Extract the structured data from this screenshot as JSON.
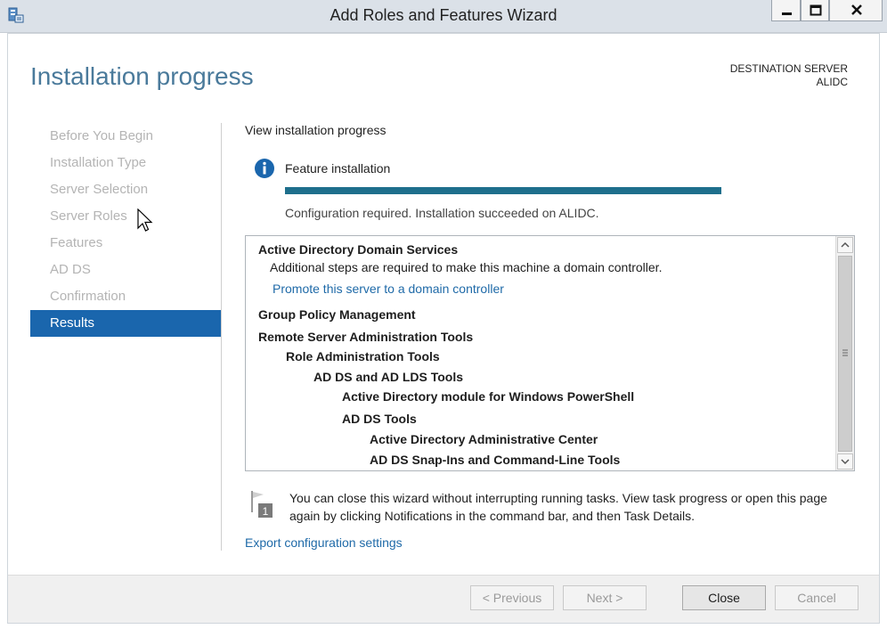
{
  "window": {
    "title": "Add Roles and Features Wizard",
    "icon": "server-manager-icon"
  },
  "header": {
    "page_title": "Installation progress",
    "destination_label": "DESTINATION SERVER",
    "destination_server": "ALIDC"
  },
  "sidebar": {
    "items": [
      {
        "label": "Before You Begin",
        "active": false
      },
      {
        "label": "Installation Type",
        "active": false
      },
      {
        "label": "Server Selection",
        "active": false
      },
      {
        "label": "Server Roles",
        "active": false
      },
      {
        "label": "Features",
        "active": false
      },
      {
        "label": "AD DS",
        "active": false
      },
      {
        "label": "Confirmation",
        "active": false
      },
      {
        "label": "Results",
        "active": true
      }
    ]
  },
  "main": {
    "section_label": "View installation progress",
    "feature_label": "Feature installation",
    "progress_fraction": 1.0,
    "status_text": "Configuration required. Installation succeeded on ALIDC.",
    "results": [
      {
        "text": "Active Directory Domain Services",
        "style": "bold"
      },
      {
        "text": "Additional steps are required to make this machine a domain controller.",
        "style": "plain"
      },
      {
        "text": "Promote this server to a domain controller",
        "style": "link"
      },
      {
        "text": "Group Policy Management",
        "style": "bold"
      },
      {
        "text": "Remote Server Administration Tools",
        "style": "bold"
      },
      {
        "text": "Role Administration Tools",
        "style": "bold"
      },
      {
        "text": "AD DS and AD LDS Tools",
        "style": "bold"
      },
      {
        "text": "Active Directory module for Windows PowerShell",
        "style": "bold"
      },
      {
        "text": "AD DS Tools",
        "style": "bold"
      },
      {
        "text": "Active Directory Administrative Center",
        "style": "bold"
      },
      {
        "text": "AD DS Snap-Ins and Command-Line Tools",
        "style": "bold"
      }
    ],
    "note_text": "You can close this wizard without interrupting running tasks. View task progress or open this page again by clicking Notifications in the command bar, and then Task Details.",
    "note_icon_badge": "1",
    "export_link": "Export configuration settings"
  },
  "footer": {
    "previous": "< Previous",
    "next": "Next >",
    "close": "Close",
    "cancel": "Cancel"
  },
  "colors": {
    "accent": "#1a66ad",
    "title_text": "#4a7a9b",
    "progress": "#1e6f8c",
    "link": "#1f6aa8"
  }
}
